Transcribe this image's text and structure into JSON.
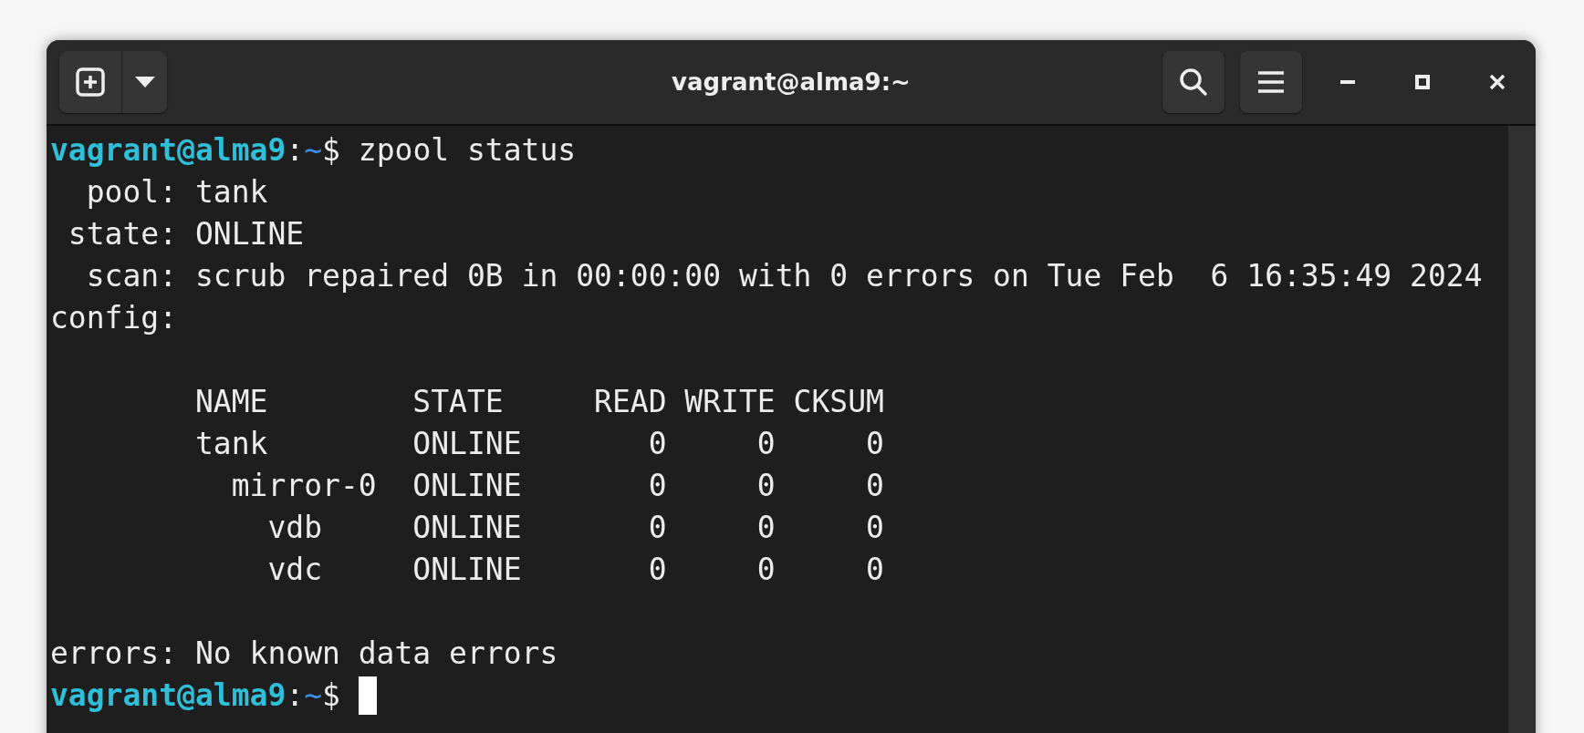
{
  "window": {
    "title": "vagrant@alma9:~"
  },
  "terminal": {
    "lines": [
      {
        "kind": "prompt",
        "prompt": {
          "user": "vagrant@alma9",
          "separator": ":",
          "path": "~",
          "symbol": "$"
        },
        "command": "zpool status",
        "cursor": false
      },
      {
        "kind": "output",
        "text": "  pool: tank"
      },
      {
        "kind": "output",
        "text": " state: ONLINE"
      },
      {
        "kind": "output",
        "text": "  scan: scrub repaired 0B in 00:00:00 with 0 errors on Tue Feb  6 16:35:49 2024"
      },
      {
        "kind": "output",
        "text": "config:"
      },
      {
        "kind": "blank"
      },
      {
        "kind": "output",
        "text": "        NAME        STATE     READ WRITE CKSUM"
      },
      {
        "kind": "output",
        "text": "        tank        ONLINE       0     0     0"
      },
      {
        "kind": "output",
        "text": "          mirror-0  ONLINE       0     0     0"
      },
      {
        "kind": "output",
        "text": "            vdb     ONLINE       0     0     0"
      },
      {
        "kind": "output",
        "text": "            vdc     ONLINE       0     0     0"
      },
      {
        "kind": "blank"
      },
      {
        "kind": "output",
        "text": "errors: No known data errors"
      },
      {
        "kind": "prompt",
        "prompt": {
          "user": "vagrant@alma9",
          "separator": ":",
          "path": "~",
          "symbol": "$"
        },
        "cursor": true
      }
    ]
  }
}
